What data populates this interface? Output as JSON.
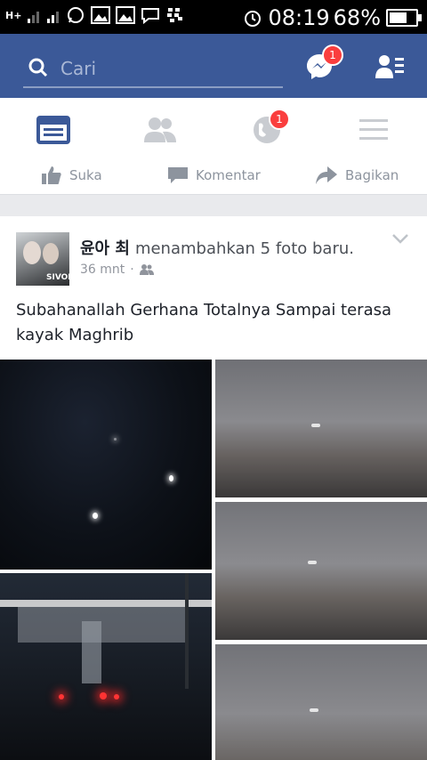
{
  "statusbar": {
    "network": "H+",
    "time": "08:19",
    "battery": "68%",
    "battery_level": 0.68
  },
  "topbar": {
    "search_placeholder": "Cari",
    "messages_badge": "1"
  },
  "tabs": {
    "notifications_badge": "1"
  },
  "actions": {
    "like": "Suka",
    "comment": "Komentar",
    "share": "Bagikan"
  },
  "post": {
    "author": "윤아 최",
    "action": "menambahkan 5 foto baru.",
    "time": "36 mnt",
    "privacy_icon": "friends-icon",
    "caption": "Subahanallah Gerhana Totalnya Sampai terasa kayak Maghrib"
  },
  "colors": {
    "brand": "#3b5998",
    "badge": "#fa3e3e"
  }
}
